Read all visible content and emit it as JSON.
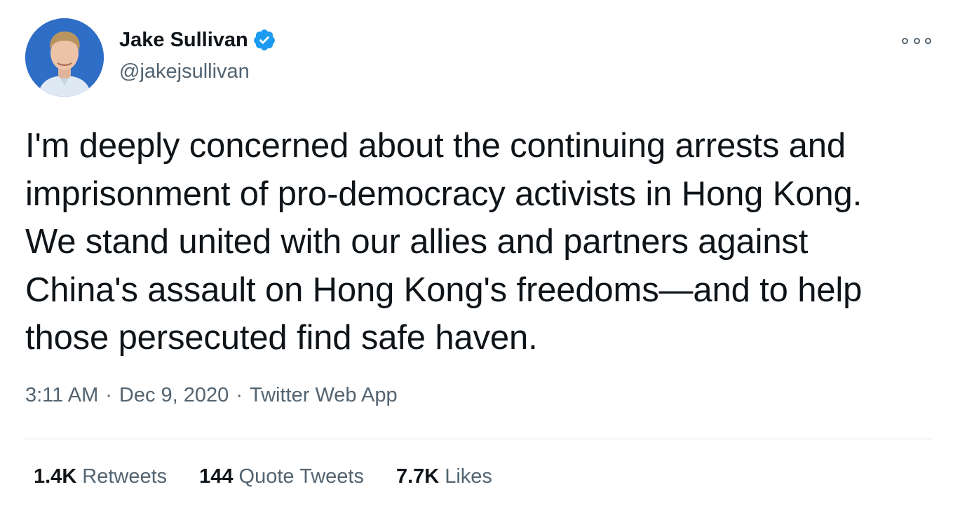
{
  "author": {
    "display_name": "Jake Sullivan",
    "handle": "@jakejsullivan",
    "verified": true
  },
  "tweet": {
    "text": "I'm deeply concerned about the continuing arrests and\nimprisonment of pro-democracy activists in Hong Kong.\nWe stand united with our allies and partners against\nChina's assault on Hong Kong's freedoms—and to help\nthose persecuted find safe haven."
  },
  "meta": {
    "time": "3:11 AM",
    "separator": "·",
    "date": "Dec 9, 2020",
    "source": "Twitter Web App"
  },
  "stats": [
    {
      "value": "1.4K",
      "label": "Retweets"
    },
    {
      "value": "144",
      "label": "Quote Tweets"
    },
    {
      "value": "7.7K",
      "label": "Likes"
    }
  ],
  "colors": {
    "verified_blue": "#1d9bf0",
    "secondary_text": "#536471",
    "primary_text": "#0f1419",
    "avatar_background": "#2f6ec7"
  },
  "icons": {
    "verified": "verified-badge-icon",
    "more": "more-options-icon"
  }
}
